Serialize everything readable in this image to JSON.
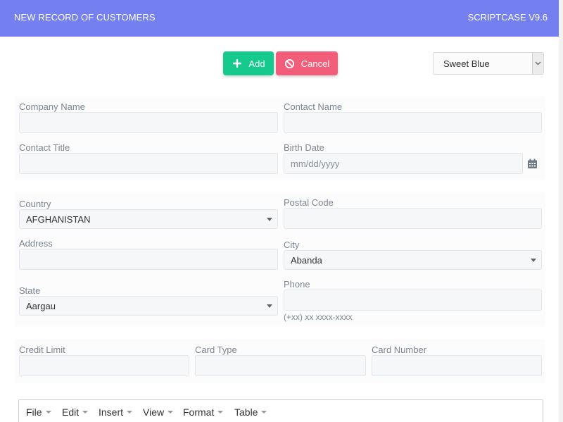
{
  "header": {
    "title": "NEW RECORD OF CUSTOMERS",
    "version": "SCRIPTCASE V9.6"
  },
  "toolbar": {
    "add_label": "Add",
    "cancel_label": "Cancel",
    "theme_value": "Sweet Blue"
  },
  "colors": {
    "header_bg": "#7580f0",
    "add_bg": "#16c98d",
    "cancel_bg": "#f25e7a"
  },
  "icons": {
    "add": "plus-icon",
    "cancel": "ban-icon",
    "date": "calendar-icon"
  },
  "form": {
    "company_name": {
      "label": "Company Name",
      "value": ""
    },
    "contact_name": {
      "label": "Contact Name",
      "value": ""
    },
    "contact_title": {
      "label": "Contact Title",
      "value": ""
    },
    "birth_date": {
      "label": "Birth Date",
      "placeholder": "mm/dd/yyyy"
    },
    "country": {
      "label": "Country",
      "value": "AFGHANISTAN"
    },
    "postal_code": {
      "label": "Postal Code",
      "value": ""
    },
    "address": {
      "label": "Address",
      "value": ""
    },
    "city": {
      "label": "City",
      "value": "Abanda"
    },
    "state": {
      "label": "State",
      "value": "Aargau"
    },
    "phone": {
      "label": "Phone",
      "hint": "(+xx) xx xxxx-xxxx"
    },
    "credit_limit": {
      "label": "Credit Limit",
      "value": ""
    },
    "card_type": {
      "label": "Card Type",
      "value": ""
    },
    "card_number": {
      "label": "Card Number",
      "value": ""
    }
  },
  "editor_menu": [
    "File",
    "Edit",
    "Insert",
    "View",
    "Format",
    "Table"
  ]
}
